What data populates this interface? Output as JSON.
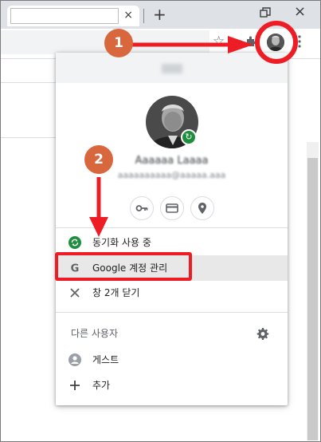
{
  "browser": {
    "tab_close": "×",
    "new_tab": "+",
    "window_close": "×"
  },
  "annotations": {
    "step1": "1",
    "step2": "2",
    "accent_color": "#ee1c24",
    "badge_color": "#d9673e"
  },
  "profile_menu": {
    "sync_status": "동기화 사용 중",
    "manage_account": "Google 계정 관리",
    "close_windows": "창 2개 닫기",
    "other_users_heading": "다른 사용자",
    "guest": "게스트",
    "add": "추가",
    "icons": {
      "passwords": "key-icon",
      "payments": "credit-card-icon",
      "addresses": "location-pin-icon"
    },
    "sync_color": "#1e8e3e"
  }
}
